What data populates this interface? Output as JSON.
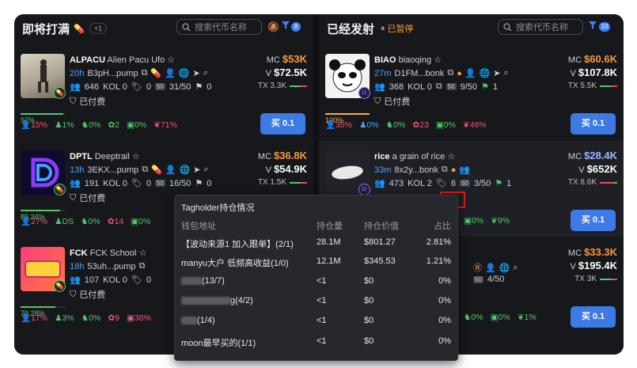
{
  "left": {
    "title": "即将打满",
    "count": "+1",
    "search_placeholder": "搜索代币名称",
    "filter_count": "8",
    "tokens": [
      {
        "symbol": "ALPACU",
        "name": "Alien Pacu Ufo",
        "age": "20h",
        "address": "B3pH...pump",
        "holders": "646",
        "kol": "KOL 0",
        "pills": "0",
        "top50": "31/50",
        "flags": "0",
        "paid": "已付费",
        "mc_label": "MC",
        "mc": "$53K",
        "vol_label": "V",
        "vol": "$72.5K",
        "tx": "TX 3.3K",
        "progress_pct": "97%",
        "progress": 0.97,
        "stats": [
          "15%",
          "1%",
          "0%",
          "2",
          "0%",
          "71%"
        ],
        "buy": "买 0.1"
      },
      {
        "symbol": "DPTL",
        "name": "Deeptrail",
        "age": "13h",
        "address": "3EKX...pump",
        "holders": "191",
        "kol": "KOL 0",
        "pills": "0",
        "top50": "16/50",
        "flags": "0",
        "paid": "已付费",
        "mc_label": "MC",
        "mc": "$36.8K",
        "vol_label": "V",
        "vol": "$54.9K",
        "tx": "TX 1.5K",
        "progress_pct": "89.34%",
        "progress": 0.8934,
        "stats": [
          "27%",
          "DS",
          "0%",
          "14",
          "0%"
        ],
        "buy": "买 0.1"
      },
      {
        "symbol": "FCK",
        "name": "FCK School",
        "age": "18h",
        "address": "53uh...pump",
        "holders": "107",
        "kol": "KOL 0",
        "pills": "0",
        "top50": "",
        "flags": "",
        "paid": "已付费",
        "progress_pct": "79.28%",
        "progress": 0.7928,
        "stats": [
          "17%",
          "3%",
          "0%",
          "9",
          "38%"
        ]
      }
    ]
  },
  "right": {
    "title": "已经发射",
    "paused": "已暂停",
    "search_placeholder": "搜索代币名称",
    "filter_count": "10",
    "tokens": [
      {
        "symbol": "BIAO",
        "name": "biaoqing",
        "age": "27m",
        "address": "D1FM...bonk",
        "holders": "368",
        "kol": "KOL 0",
        "pills": "",
        "top50": "9/50",
        "flags": "1",
        "paid": "已付费",
        "mc_label": "MC",
        "mc": "$60.6K",
        "vol_label": "V",
        "vol": "$107.8K",
        "tx": "TX 5.5K",
        "progress_pct": "100%",
        "progress": 1.0,
        "stats": [
          "35%",
          "0%",
          "0%",
          "23",
          "0%",
          "46%"
        ],
        "buy": "买 0.1"
      },
      {
        "symbol": "rice",
        "name": "a grain of rice",
        "age": "33m",
        "address": "8x2y...bonk",
        "holders": "473",
        "kol": "KOL 2",
        "pills": "6",
        "top50": "3/50",
        "flags": "1",
        "mc_label": "MC",
        "mc": "$28.4K",
        "vol_label": "V",
        "vol": "$652K",
        "tx": "TX 8.6K",
        "stats": [
          "0%",
          "9%"
        ],
        "buy": "买 0.1"
      },
      {
        "mc_label": "MC",
        "mc": "$33.3K",
        "vol_label": "V",
        "vol": "$195.4K",
        "tx": "TX 3K",
        "top50": "4/50",
        "stats": [
          "0%",
          "0%",
          "1%"
        ],
        "buy": "买 0.1"
      }
    ]
  },
  "tooltip": {
    "title": "Tagholder持仓情况",
    "headers": [
      "钱包地址",
      "持仓量",
      "持仓价值",
      "占比"
    ],
    "rows": [
      {
        "wallet": "【波动来源1 加入跟单】(2/1)",
        "amount": "28.1M",
        "value": "$801.27",
        "share": "2.81%"
      },
      {
        "wallet": "manyu大户 低频高收益(1/0)",
        "amount": "12.1M",
        "value": "$345.53",
        "share": "1.21%"
      },
      {
        "wallet": "(13/7)",
        "amount": "<1",
        "value": "$0",
        "share": "0%"
      },
      {
        "wallet": "g(4/2)",
        "amount": "<1",
        "value": "$0",
        "share": "0%"
      },
      {
        "wallet": "(1/4)",
        "amount": "<1",
        "value": "$0",
        "share": "0%"
      },
      {
        "wallet": "moon最早买的(1/1)",
        "amount": "<1",
        "value": "$0",
        "share": "0%"
      }
    ]
  },
  "colors": {
    "accent": "#3d7ae5",
    "mc": "#f59a3c",
    "green": "#58c56a",
    "red": "#e0505a",
    "highlight_box": "#e0181b"
  }
}
